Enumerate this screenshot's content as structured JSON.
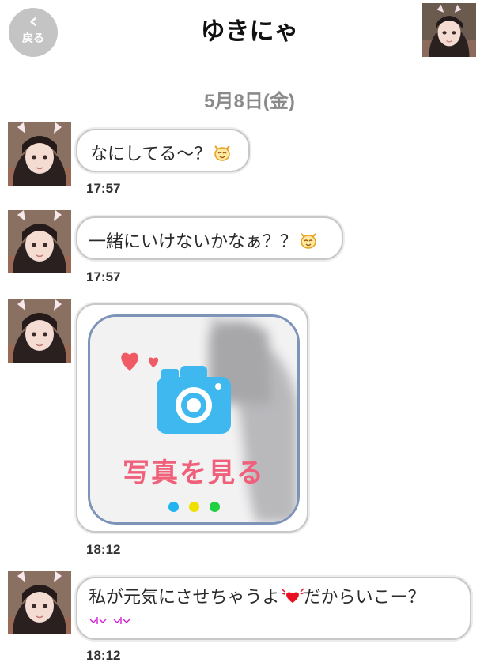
{
  "header": {
    "back_icon": "chevron-left",
    "back_label": "戻る",
    "title": "ゆきにゃ",
    "avatar": "profile-photo"
  },
  "date_label": "5月8日(金)",
  "messages": [
    {
      "text": "なにしてる〜？",
      "emoji": "cat-face-icon",
      "time": "17:57"
    },
    {
      "text": "一緒にいけないかなぁ？？",
      "emoji": "cat-face-icon",
      "time": "17:57"
    },
    {
      "photo_label": "写真を見る",
      "time": "18:12"
    },
    {
      "text_line1_a": "私が元気にさせちゃうよ",
      "text_line1_b": "だからいこー？",
      "emoji": "winged-heart-icon",
      "decoration": "sparkle-icons",
      "time": "18:12"
    }
  ],
  "colors": {
    "photo_label": "#f0607a",
    "camera": "#3fb8f0",
    "hearts": "#f05a64",
    "dots": [
      "#20b4f0",
      "#f0e000",
      "#20d040"
    ],
    "date": "#8a8a8a"
  }
}
